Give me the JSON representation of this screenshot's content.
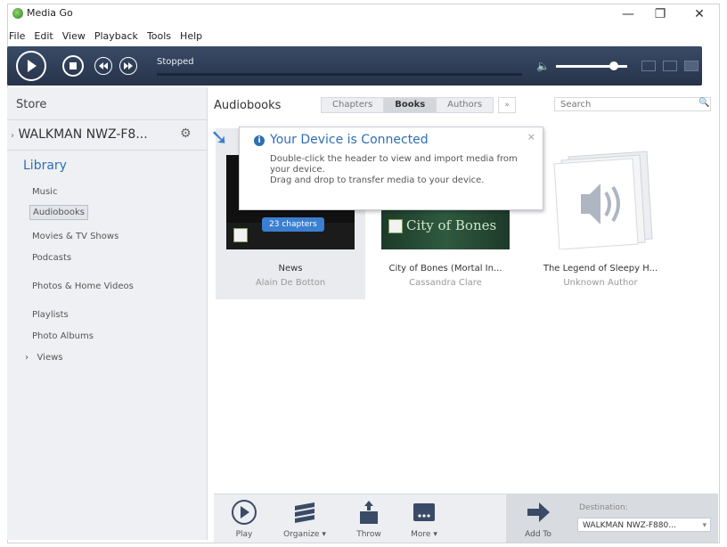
{
  "window": {
    "title": "Media Go",
    "controls": {
      "minimize": "—",
      "maximize": "❐",
      "close": "✕"
    }
  },
  "menu": [
    "File",
    "Edit",
    "View",
    "Playback",
    "Tools",
    "Help"
  ],
  "transport": {
    "status": "Stopped",
    "volume_level": 0.75
  },
  "sidebar": {
    "store": "Store",
    "device": "WALKMAN NWZ-F8...",
    "library_heading": "Library",
    "items": [
      {
        "label": "Music"
      },
      {
        "label": "Audiobooks",
        "selected": true
      },
      {
        "label": "Movies & TV Shows"
      },
      {
        "label": "Podcasts"
      },
      {
        "label": "Photos & Home Videos"
      },
      {
        "label": "Playlists"
      },
      {
        "label": "Photo Albums"
      },
      {
        "label": "Views",
        "expander": "›"
      }
    ]
  },
  "content": {
    "title": "Audiobooks",
    "tabs": [
      {
        "label": "Chapters",
        "active": false
      },
      {
        "label": "Books",
        "active": true
      },
      {
        "label": "Authors",
        "active": false
      }
    ],
    "tab_more": "»",
    "search_placeholder": "Search"
  },
  "books": [
    {
      "title": "News",
      "author": "Alain De Botton",
      "badge": "23 chapters",
      "selected": true
    },
    {
      "title": "City of Bones (Mortal In...",
      "author": "Cassandra Clare",
      "cover_text": "City of Bones"
    },
    {
      "title": "The Legend of Sleepy H...",
      "author": "Unknown Author"
    }
  ],
  "popup": {
    "title": "Your Device is Connected",
    "line1": "Double-click the header to view and import media from your device.",
    "line2": "Drag and drop to transfer media to your device.",
    "close": "×"
  },
  "toolbar": {
    "play": "Play",
    "organize": "Organize ▾",
    "throw": "Throw",
    "more": "More ▾",
    "add_to": "Add To",
    "destination_label": "Destination:",
    "destination_value": "WALKMAN NWZ-F880..."
  },
  "colors": {
    "accent": "#2f6fb3",
    "transport_bg": "#2d3a52"
  }
}
